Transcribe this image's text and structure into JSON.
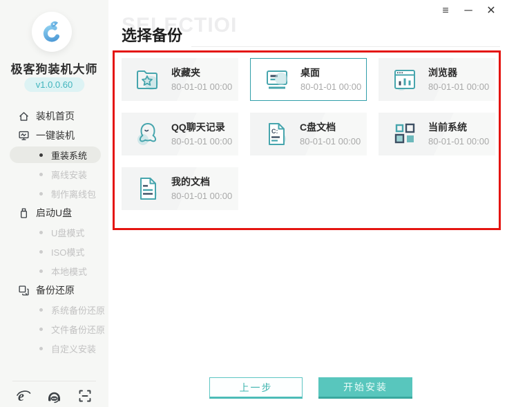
{
  "window": {
    "controls": {
      "menu_icon": "≡",
      "minimize_icon": "─",
      "close_icon": "✕"
    }
  },
  "sidebar": {
    "app_name": "极客狗装机大师",
    "version": "v1.0.0.60",
    "items": [
      {
        "label": "装机首页",
        "type": "top",
        "icon": "home-icon",
        "active": false
      },
      {
        "label": "一键装机",
        "type": "top",
        "icon": "monitor-icon",
        "active": false
      },
      {
        "label": "重装系统",
        "type": "sub",
        "active": true
      },
      {
        "label": "离线安装",
        "type": "sub",
        "active": false
      },
      {
        "label": "制作离线包",
        "type": "sub",
        "active": false
      },
      {
        "label": "启动U盘",
        "type": "top",
        "icon": "usb-icon",
        "active": false
      },
      {
        "label": "U盘模式",
        "type": "sub",
        "active": false
      },
      {
        "label": "ISO模式",
        "type": "sub",
        "active": false
      },
      {
        "label": "本地模式",
        "type": "sub",
        "active": false
      },
      {
        "label": "备份还原",
        "type": "top",
        "icon": "restore-icon",
        "active": false
      },
      {
        "label": "系统备份还原",
        "type": "sub",
        "active": false
      },
      {
        "label": "文件备份还原",
        "type": "sub",
        "active": false
      },
      {
        "label": "自定义安装",
        "type": "sub",
        "active": false
      }
    ],
    "footer_icons": [
      "ie-browser-icon",
      "support-headset-icon",
      "scan-icon"
    ]
  },
  "header": {
    "title": "选择备份",
    "watermark": "SELECTIOI"
  },
  "backup": {
    "cards": [
      {
        "title": "收藏夹",
        "timestamp": "80-01-01 00:00",
        "icon": "folder-star-icon",
        "selected": false
      },
      {
        "title": "桌面",
        "timestamp": "80-01-01 00:00",
        "icon": "desktop-icon",
        "selected": true
      },
      {
        "title": "浏览器",
        "timestamp": "80-01-01 00:00",
        "icon": "browser-icon",
        "selected": false
      },
      {
        "title": "QQ聊天记录",
        "timestamp": "80-01-01 00:00",
        "icon": "qq-icon",
        "selected": false
      },
      {
        "title": "C盘文档",
        "timestamp": "80-01-01 00:00",
        "icon": "c-drive-doc-icon",
        "selected": false
      },
      {
        "title": "当前系统",
        "timestamp": "80-01-01 00:00",
        "icon": "current-system-icon",
        "selected": false
      },
      {
        "title": "我的文档",
        "timestamp": "80-01-01 00:00",
        "icon": "my-documents-icon",
        "selected": false
      }
    ]
  },
  "footer": {
    "prev_label": "上一步",
    "start_label": "开始安装"
  },
  "colors": {
    "accent_teal": "#46a5ad",
    "navy": "#3d4f63",
    "highlight_red": "#e41410",
    "version_teal": "#40b4bd"
  }
}
